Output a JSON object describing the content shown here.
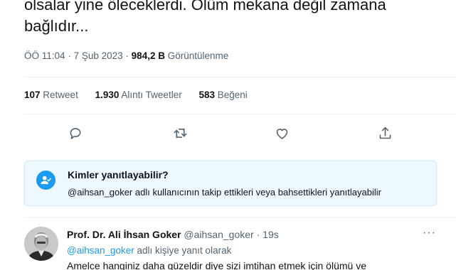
{
  "tweet": {
    "text": "olsalar yine öleceklerdi. Ölüm mekana değil zamana bağlıdır...",
    "time": "ÖÖ 11:04",
    "separator": "·",
    "date": "7 Şub 2023",
    "views_count": "984,2 B",
    "views_label": "Görüntülenme"
  },
  "stats": {
    "retweets_count": "107",
    "retweets_label": "Retweet",
    "quotes_count": "1.930",
    "quotes_label": "Alıntı Tweetler",
    "likes_count": "583",
    "likes_label": "Beğeni"
  },
  "actions": [
    {
      "icon": "comment-icon"
    },
    {
      "icon": "retweet-icon"
    },
    {
      "icon": "heart-icon"
    },
    {
      "icon": "share-icon"
    }
  ],
  "reply_settings": {
    "title": "Kimler yanıtlayabilir?",
    "description": "@aihsan_goker adlı kullanıcının takip ettikleri veya bahsettikleri yanıtlayabilir"
  },
  "reply": {
    "author_name": "Prof. Dr. Ali İhsan Goker",
    "handle": "@aihsan_goker",
    "separator": "·",
    "time": "19s",
    "more": "···",
    "mention": "@aihsan_goker",
    "reply_to_text": " adlı kişiye yanıt olarak",
    "body": "Amelce hanginiz daha güzeldir diye sizi imtihan etmek için ölümü ve"
  },
  "colors": {
    "accent": "#1d9bf0",
    "text": "#0f1419",
    "secondary": "#536471",
    "reply_box_bg": "#eef8ff"
  }
}
